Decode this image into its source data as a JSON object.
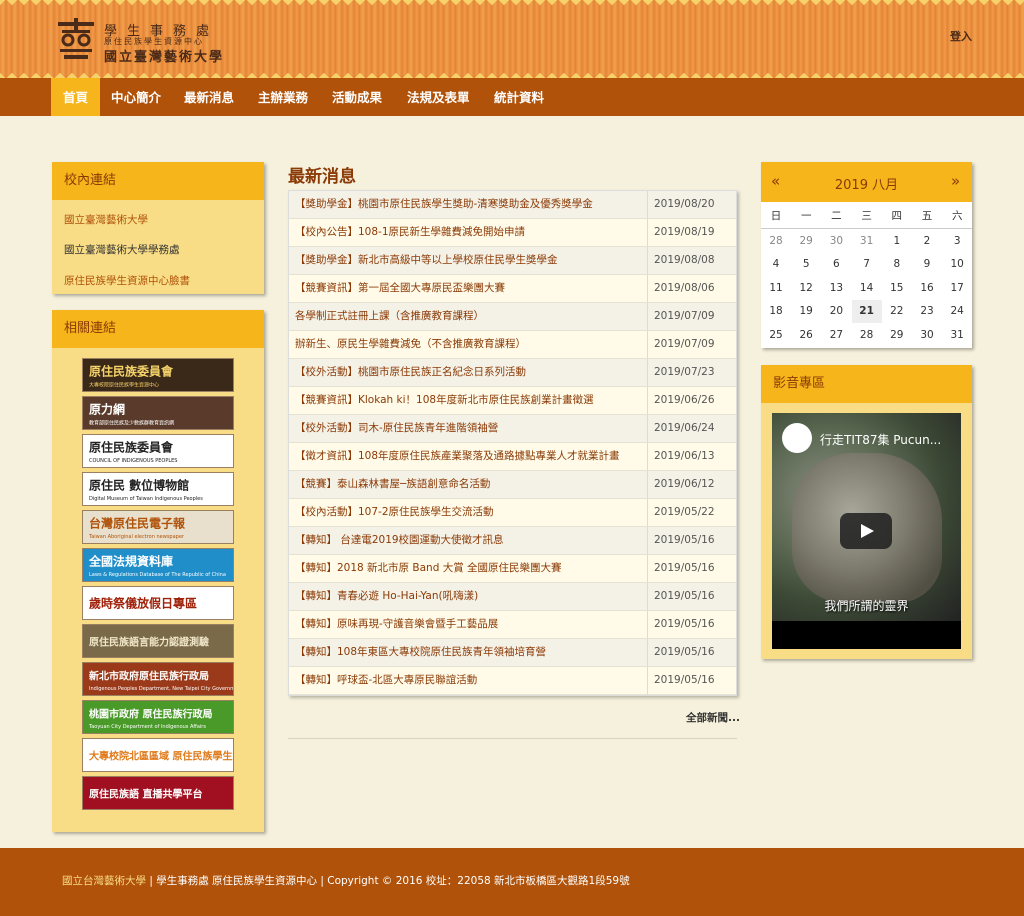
{
  "header": {
    "logo_line1": "學生事務處",
    "logo_line2": "原住民族學生資源中心",
    "logo_line3": "國立臺灣藝術大學",
    "logo_char": "藝",
    "login": "登入"
  },
  "nav": {
    "items": [
      {
        "label": "首頁",
        "active": true
      },
      {
        "label": "中心簡介"
      },
      {
        "label": "最新消息"
      },
      {
        "label": "主辦業務"
      },
      {
        "label": "活動成果"
      },
      {
        "label": "法規及表單"
      },
      {
        "label": "統計資料"
      }
    ]
  },
  "campus_links": {
    "title": "校內連結",
    "items": [
      {
        "label": "國立臺灣藝術大學"
      },
      {
        "label": "國立臺灣藝術大學學務處"
      },
      {
        "label": "原住民族學生資源中心臉書"
      }
    ]
  },
  "related_links": {
    "title": "相關連結",
    "banners": [
      {
        "label": "原住民族委員會",
        "sub": "大專校院原住民族學生資源中心",
        "bg": "#3a2818",
        "fg": "#f5d36a"
      },
      {
        "label": "原力網",
        "sub": "教育部原住民族及少數族群教育資訊網",
        "bg": "#5a3a2a",
        "fg": "#ffffff"
      },
      {
        "label": "原住民族委員會",
        "sub": "COUNCIL OF INDIGENOUS PEOPLES",
        "bg": "#ffffff",
        "fg": "#222222"
      },
      {
        "label": "原住民 數位博物館",
        "sub": "Digital Museum of Taiwan Indigenous Peoples",
        "bg": "#ffffff",
        "fg": "#222222"
      },
      {
        "label": "台灣原住民電子報",
        "sub": "Taiwan Aboriginal electron newspaper",
        "bg": "#e8e0cc",
        "fg": "#b0520a"
      },
      {
        "label": "全國法規資料庫",
        "sub": "Laws & Regulations Database of The Republic of China",
        "bg": "#1f8ec9",
        "fg": "#ffffff"
      },
      {
        "label": "歲時祭儀放假日專區",
        "sub": "",
        "bg": "#ffffff",
        "fg": "#a0220a"
      },
      {
        "label": "原住民族語言能力認證測驗",
        "sub": "",
        "bg": "#7a6a4a",
        "fg": "#f0e6c8"
      },
      {
        "label": "新北市政府原住民族行政局",
        "sub": "Indigenous Peoples Department, New Taipei City Government",
        "bg": "#9a3a1a",
        "fg": "#ffffff"
      },
      {
        "label": "桃園市政府 原住民族行政局",
        "sub": "Taoyuan City Department of Indigenous Affairs",
        "bg": "#4a9a2a",
        "fg": "#ffffff"
      },
      {
        "label": "大專校院北區區域 原住民族學生資源中心",
        "sub": "",
        "bg": "#ffffff",
        "fg": "#e07a1a"
      },
      {
        "label": "原住民族語 直播共學平台",
        "sub": "",
        "bg": "#a01020",
        "fg": "#ffffff"
      }
    ]
  },
  "news": {
    "title": "最新消息",
    "more": "全部新聞...",
    "items": [
      {
        "text": "【獎助學金】桃園市原住民族學生獎助-清寒獎助金及優秀獎學金",
        "date": "2019/08/20"
      },
      {
        "text": "【校內公告】108-1原民新生學雜費減免開始申請",
        "date": "2019/08/19"
      },
      {
        "text": "【獎助學金】新北市高級中等以上學校原住民學生獎學金",
        "date": "2019/08/08"
      },
      {
        "text": "【競賽資訊】第一屆全國大專原民盃樂團大賽",
        "date": "2019/08/06"
      },
      {
        "text": "各學制正式註冊上課（含推廣教育課程）",
        "date": "2019/07/09"
      },
      {
        "text": "辦新生、原民生學雜費減免（不含推廣教育課程）",
        "date": "2019/07/09"
      },
      {
        "text": "【校外活動】桃園市原住民族正名紀念日系列活動",
        "date": "2019/07/23"
      },
      {
        "text": "【競賽資訊】Klokah ki！108年度新北市原住民族創業計畫徵選",
        "date": "2019/06/26"
      },
      {
        "text": "【校外活動】司木-原住民族青年進階領袖營",
        "date": "2019/06/24"
      },
      {
        "text": "【徵才資訊】108年度原住民族產業聚落及通路據點專業人才就業計畫",
        "date": "2019/06/13"
      },
      {
        "text": "【競賽】泰山森林書屋─族語創意命名活動",
        "date": "2019/06/12"
      },
      {
        "text": "【校內活動】107-2原住民族學生交流活動",
        "date": "2019/05/22"
      },
      {
        "text": "【轉知】 台達電2019校園運動大使徵才訊息",
        "date": "2019/05/16"
      },
      {
        "text": "【轉知】2018 新北市原 Band 大賞 全國原住民樂團大賽",
        "date": "2019/05/16"
      },
      {
        "text": "【轉知】青春必遊 Ho-Hai-Yan(吼嗨漾)",
        "date": "2019/05/16"
      },
      {
        "text": "【轉知】原味再現-守護音樂會暨手工藝品展",
        "date": "2019/05/16"
      },
      {
        "text": "【轉知】108年東區大專校院原住民族青年領袖培育營",
        "date": "2019/05/16"
      },
      {
        "text": "【轉知】呼球盃-北區大專原民聯誼活動",
        "date": "2019/05/16"
      }
    ]
  },
  "calendar": {
    "prev": "«",
    "next": "»",
    "title": "2019 八月",
    "weekdays": [
      "日",
      "一",
      "二",
      "三",
      "四",
      "五",
      "六"
    ],
    "weeks": [
      [
        "28",
        "29",
        "30",
        "31",
        "1",
        "2",
        "3"
      ],
      [
        "4",
        "5",
        "6",
        "7",
        "8",
        "9",
        "10"
      ],
      [
        "11",
        "12",
        "13",
        "14",
        "15",
        "16",
        "17"
      ],
      [
        "18",
        "19",
        "20",
        "21",
        "22",
        "23",
        "24"
      ],
      [
        "25",
        "26",
        "27",
        "28",
        "29",
        "30",
        "31"
      ]
    ],
    "muted_prefix_count": 4,
    "today": "21"
  },
  "video": {
    "panel_title": "影音專區",
    "title": "行走TIT87集 Pucun...",
    "caption": "我們所謂的靈界"
  },
  "footer": {
    "highlight": "國立台灣藝術大學",
    "text": " | 學生事務處 原住民族學生資源中心 | Copyright © 2016 校址：22058 新北市板橋區大觀路1段59號"
  }
}
